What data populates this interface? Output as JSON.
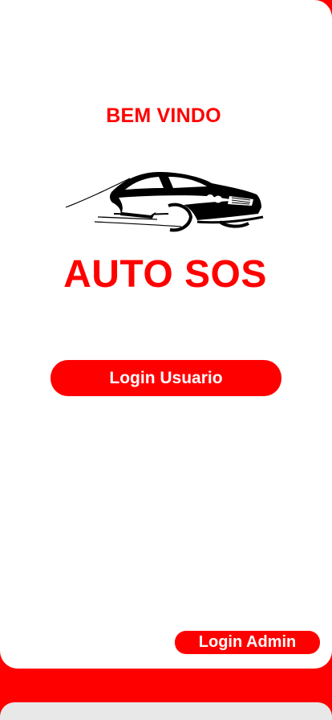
{
  "colors": {
    "accent": "#ff0000",
    "background": "#ffffff",
    "button_text": "#ffffff",
    "logo": "#000000",
    "bottom_bar": "#e8e8e8"
  },
  "welcome": {
    "title": "BEM VINDO"
  },
  "logo": {
    "icon": "car-logo-icon"
  },
  "app": {
    "name": "AUTO SOS"
  },
  "buttons": {
    "user_login": "Login Usuario",
    "admin_login": "Login Admin"
  }
}
